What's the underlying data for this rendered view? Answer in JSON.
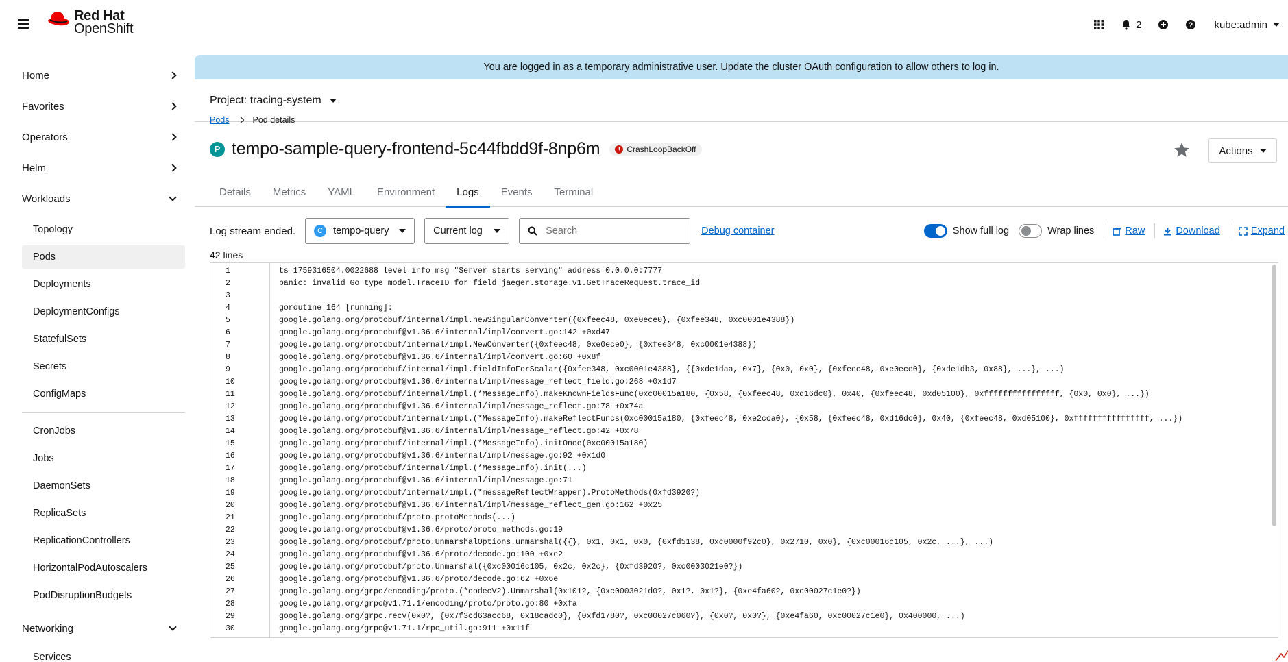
{
  "masthead": {
    "brand_line1": "Red Hat",
    "brand_line2": "OpenShift",
    "notifications_count": "2",
    "user": "kube:admin",
    "icons": [
      "grid-icon",
      "bell-icon",
      "plus-circle-icon",
      "help-icon"
    ]
  },
  "sidebar": {
    "sections": [
      {
        "label": "Home",
        "expanded": false
      },
      {
        "label": "Favorites",
        "expanded": false
      },
      {
        "label": "Operators",
        "expanded": false
      },
      {
        "label": "Helm",
        "expanded": false
      },
      {
        "label": "Workloads",
        "expanded": true
      },
      {
        "label": "Networking",
        "expanded": true
      }
    ],
    "workloads_items": [
      "Topology",
      "Pods",
      "Deployments",
      "DeploymentConfigs",
      "StatefulSets",
      "Secrets",
      "ConfigMaps",
      "CronJobs",
      "Jobs",
      "DaemonSets",
      "ReplicaSets",
      "ReplicationControllers",
      "HorizontalPodAutoscalers",
      "PodDisruptionBudgets"
    ],
    "active_item": "Pods",
    "networking_items": [
      "Services"
    ]
  },
  "banner": {
    "before": "You are logged in as a temporary administrative user. Update the",
    "link": "cluster OAuth configuration",
    "after": "to allow others to log in."
  },
  "project": {
    "label": "Project: tracing-system"
  },
  "breadcrumb": {
    "link": "Pods",
    "current": "Pod details"
  },
  "pod": {
    "badge": "P",
    "name": "tempo-sample-query-frontend-5c44fbdd9f-8np6m",
    "status": "CrashLoopBackOff"
  },
  "actions_label": "Actions",
  "tabs": [
    {
      "label": "Details",
      "active": false
    },
    {
      "label": "Metrics",
      "active": false
    },
    {
      "label": "YAML",
      "active": false
    },
    {
      "label": "Environment",
      "active": false
    },
    {
      "label": "Logs",
      "active": true
    },
    {
      "label": "Events",
      "active": false
    },
    {
      "label": "Terminal",
      "active": false
    }
  ],
  "log_toolbar": {
    "stream_status": "Log stream ended.",
    "container_badge": "C",
    "container": "tempo-query",
    "log_type": "Current log",
    "search_placeholder": "Search",
    "debug_link": "Debug container",
    "show_full_log_label": "Show full log",
    "show_full_log_on": true,
    "wrap_lines_label": "Wrap lines",
    "wrap_lines_on": false,
    "raw_label": "Raw",
    "download_label": "Download",
    "expand_label": "Expand"
  },
  "line_count": "42 lines",
  "log_lines": [
    "ts=1759316504.0022688 level=info msg=\"Server starts serving\" address=0.0.0.0:7777",
    "panic: invalid Go type model.TraceID for field jaeger.storage.v1.GetTraceRequest.trace_id",
    "",
    "goroutine 164 [running]:",
    "google.golang.org/protobuf/internal/impl.newSingularConverter({0xfeec48, 0xe0ece0}, {0xfee348, 0xc0001e4388})",
    "google.golang.org/protobuf@v1.36.6/internal/impl/convert.go:142 +0xd47",
    "google.golang.org/protobuf/internal/impl.NewConverter({0xfeec48, 0xe0ece0}, {0xfee348, 0xc0001e4388})",
    "google.golang.org/protobuf@v1.36.6/internal/impl/convert.go:60 +0x8f",
    "google.golang.org/protobuf/internal/impl.fieldInfoForScalar({0xfee348, 0xc0001e4388}, {{0xde1daa, 0x7}, {0x0, 0x0}, {0xfeec48, 0xe0ece0}, {0xde1db3, 0x88}, ...}, ...)",
    "google.golang.org/protobuf@v1.36.6/internal/impl/message_reflect_field.go:268 +0x1d7",
    "google.golang.org/protobuf/internal/impl.(*MessageInfo).makeKnownFieldsFunc(0xc00015a180, {0x58, {0xfeec48, 0xd16dc0}, 0x40, {0xfeec48, 0xd05100}, 0xffffffffffffffff, {0x0, 0x0}, ...})",
    "google.golang.org/protobuf@v1.36.6/internal/impl/message_reflect.go:78 +0x74a",
    "google.golang.org/protobuf/internal/impl.(*MessageInfo).makeReflectFuncs(0xc00015a180, {0xfeec48, 0xe2cca0}, {0x58, {0xfeec48, 0xd16dc0}, 0x40, {0xfeec48, 0xd05100}, 0xffffffffffffffff, ...})",
    "google.golang.org/protobuf@v1.36.6/internal/impl/message_reflect.go:42 +0x78",
    "google.golang.org/protobuf/internal/impl.(*MessageInfo).initOnce(0xc00015a180)",
    "google.golang.org/protobuf@v1.36.6/internal/impl/message.go:92 +0x1d0",
    "google.golang.org/protobuf/internal/impl.(*MessageInfo).init(...)",
    "google.golang.org/protobuf@v1.36.6/internal/impl/message.go:71",
    "google.golang.org/protobuf/internal/impl.(*messageReflectWrapper).ProtoMethods(0xfd3920?)",
    "google.golang.org/protobuf@v1.36.6/internal/impl/message_reflect_gen.go:162 +0x25",
    "google.golang.org/protobuf/proto.protoMethods(...)",
    "google.golang.org/protobuf@v1.36.6/proto/proto_methods.go:19",
    "google.golang.org/protobuf/proto.UnmarshalOptions.unmarshal({{}, 0x1, 0x1, 0x0, {0xfd5138, 0xc0000f92c0}, 0x2710, 0x0}, {0xc00016c105, 0x2c, ...}, ...)",
    "google.golang.org/protobuf@v1.36.6/proto/decode.go:100 +0xe2",
    "google.golang.org/protobuf/proto.Unmarshal({0xc00016c105, 0x2c, 0x2c}, {0xfd3920?, 0xc0003021e0?})",
    "google.golang.org/protobuf@v1.36.6/proto/decode.go:62 +0x6e",
    "google.golang.org/grpc/encoding/proto.(*codecV2).Unmarshal(0x101?, {0xc0003021d0?, 0x1?, 0x1?}, {0xe4fa60?, 0xc00027c1e0?})",
    "google.golang.org/grpc@v1.71.1/encoding/proto/proto.go:80 +0xfa",
    "google.golang.org/grpc.recv(0x0?, {0x7f3cd63acc68, 0x18cadc0}, {0xfd1780?, 0xc00027c060?}, {0x0?, 0x0?}, {0xe4fa60, 0xc00027c1e0}, 0x400000, ...)",
    "google.golang.org/grpc@v1.71.1/rpc_util.go:911 +0x11f"
  ]
}
